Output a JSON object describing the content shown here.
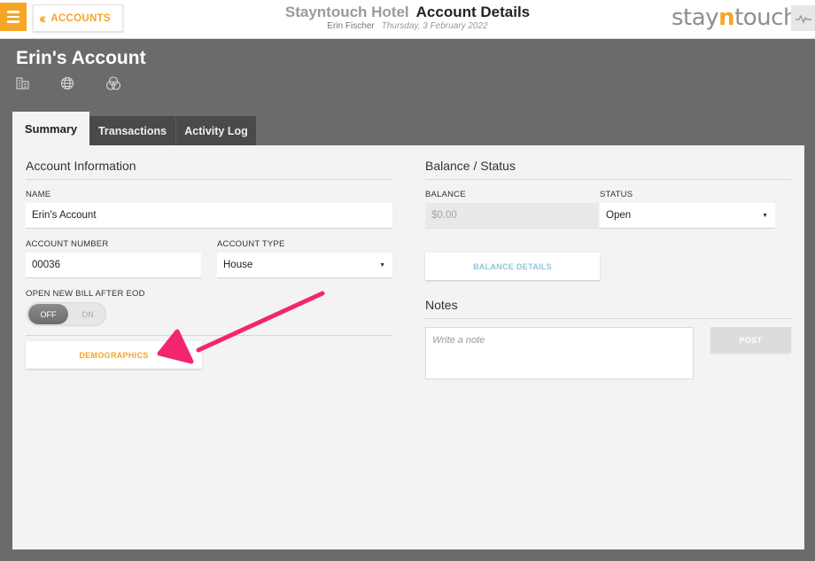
{
  "topbar": {
    "back_label": "ACCOUNTS",
    "hotel_name": "Stayntouch Hotel",
    "page_title": "Account Details",
    "user_name": "Erin Fischer",
    "date": "Thursday, 3 February 2022",
    "logo_pre": "stay",
    "logo_n": "n",
    "logo_post": "touch"
  },
  "header": {
    "account_title": "Erin's Account",
    "icons": [
      "building-icon",
      "globe-icon",
      "circles-icon"
    ]
  },
  "tabs": [
    {
      "label": "Summary",
      "active": true
    },
    {
      "label": "Transactions",
      "active": false
    },
    {
      "label": "Activity Log",
      "active": false
    }
  ],
  "account_info": {
    "title": "Account Information",
    "name_label": "NAME",
    "name_value": "Erin's Account",
    "account_number_label": "ACCOUNT NUMBER",
    "account_number_value": "00036",
    "account_type_label": "ACCOUNT TYPE",
    "account_type_value": "House",
    "bill_label": "OPEN NEW BILL AFTER EOD",
    "toggle_off": "OFF",
    "toggle_on": "ON",
    "demographics_button": "DEMOGRAPHICS"
  },
  "balance_status": {
    "title": "Balance / Status",
    "balance_label": "BALANCE",
    "balance_value": "$0.00",
    "status_label": "STATUS",
    "status_value": "Open",
    "balance_details_button": "BALANCE DETAILS"
  },
  "notes": {
    "title": "Notes",
    "placeholder": "Write a note",
    "post_button": "POST"
  },
  "colors": {
    "accent": "#f6a623",
    "annotation_arrow": "#f2266e",
    "header_bg": "#6b6b6b",
    "panel_bg": "#f3f3f3"
  }
}
